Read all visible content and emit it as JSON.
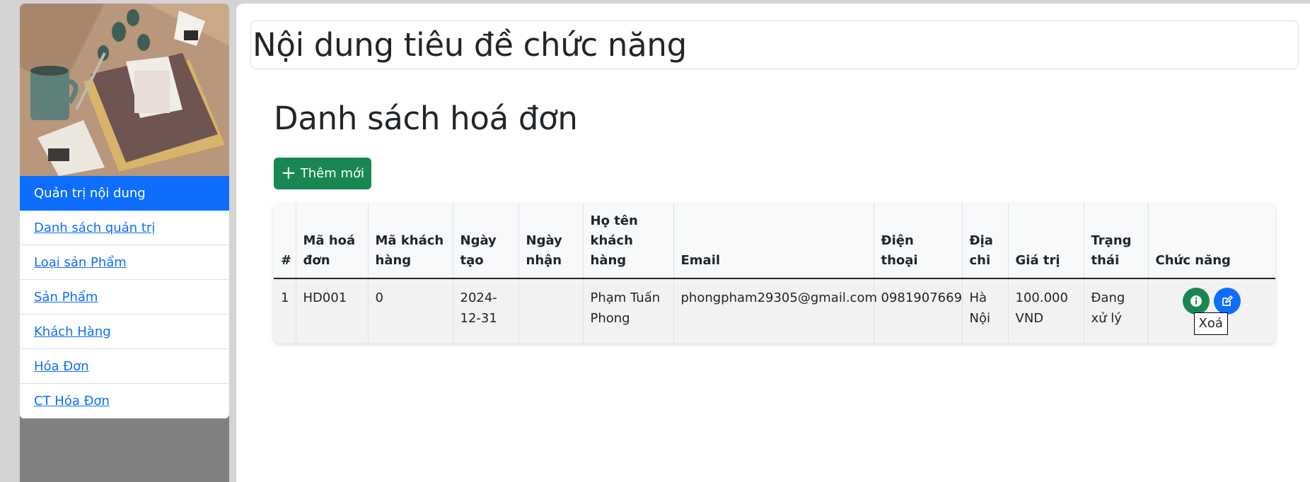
{
  "sidebar": {
    "items": [
      {
        "label": "Quản trị nội dung",
        "active": true
      },
      {
        "label": "Danh sách quản trị"
      },
      {
        "label": "Loại sản Phẩm"
      },
      {
        "label": "Sản Phẩm"
      },
      {
        "label": "Khách Hàng"
      },
      {
        "label": "Hóa Đơn"
      },
      {
        "label": "CT Hóa Đơn"
      }
    ]
  },
  "header": {
    "title": "Nội dung tiêu đề chức năng"
  },
  "main": {
    "heading": "Danh sách hoá đơn",
    "add_label": "Thêm mới",
    "table": {
      "columns": [
        "#",
        "Mã hoá đơn",
        "Mã khách hàng",
        "Ngày tạo",
        "Ngày nhận",
        "Họ tên khách hàng",
        "Email",
        "Điện thoại",
        "Địa chi",
        "Giá trị",
        "Trạng thái",
        "Chức năng"
      ],
      "rows": [
        [
          "1",
          "HD001",
          "0",
          "2024-12-31",
          "",
          "Phạm Tuấn Phong",
          "phongpham29305@gmail.com",
          "0981907669",
          "Hà Nội",
          "100.000 VND",
          "Đang xử lý"
        ]
      ]
    },
    "tooltip": "Xoá"
  },
  "colors": {
    "primary": "#0d6efd",
    "success": "#198754",
    "sidebar_bg": "#808080"
  },
  "icons": {
    "add": "plus-icon",
    "info": "info-icon",
    "edit": "edit-icon"
  }
}
